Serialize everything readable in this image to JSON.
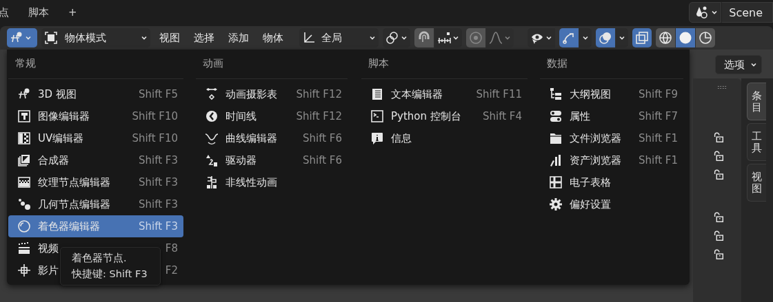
{
  "top_tabs": [
    {
      "label": "点"
    },
    {
      "label": "脚本"
    },
    {
      "label": "+"
    }
  ],
  "scene": {
    "label": "Scene"
  },
  "header": {
    "mode": "物体模式",
    "menus": [
      "视图",
      "选择",
      "添加",
      "物体"
    ],
    "orientation": "全局",
    "toggles": [
      {
        "kind": "snap",
        "on": false
      },
      {
        "kind": "proportional",
        "on": false
      },
      {
        "kind": "visibility",
        "on": false
      },
      {
        "kind": "gizmo",
        "on": true
      },
      {
        "kind": "overlay",
        "on": true
      },
      {
        "kind": "xray",
        "on": true
      }
    ],
    "shading": [
      {
        "kind": "wireframe",
        "selected": false
      },
      {
        "kind": "solid",
        "selected": true
      },
      {
        "kind": "material",
        "selected": false
      }
    ]
  },
  "editor_menu": {
    "columns": [
      {
        "heading": "常规",
        "items": [
          {
            "label": "3D 视图",
            "shortcut": "Shift F5",
            "selected": false
          },
          {
            "label": "图像编辑器",
            "shortcut": "Shift F10",
            "selected": false
          },
          {
            "label": "UV编辑器",
            "shortcut": "Shift F10",
            "selected": false
          },
          {
            "label": "合成器",
            "shortcut": "Shift F3",
            "selected": false
          },
          {
            "label": "纹理节点编辑器",
            "shortcut": "Shift F3",
            "selected": false
          },
          {
            "label": "几何节点编辑器",
            "shortcut": "Shift F3",
            "selected": false
          },
          {
            "label": "着色器编辑器",
            "shortcut": "Shift F3",
            "selected": true
          },
          {
            "label": "视频",
            "shortcut": "F8",
            "selected": false
          },
          {
            "label": "影片",
            "shortcut": "F2",
            "selected": false
          }
        ]
      },
      {
        "heading": "动画",
        "items": [
          {
            "label": "动画摄影表",
            "shortcut": "Shift F12",
            "selected": false
          },
          {
            "label": "时间线",
            "shortcut": "Shift F12",
            "selected": false
          },
          {
            "label": "曲线编辑器",
            "shortcut": "Shift F6",
            "selected": false
          },
          {
            "label": "驱动器",
            "shortcut": "Shift F6",
            "selected": false
          },
          {
            "label": "非线性动画",
            "selected": false
          }
        ]
      },
      {
        "heading": "脚本",
        "items": [
          {
            "label": "文本编辑器",
            "shortcut": "Shift F11",
            "selected": false
          },
          {
            "label": "Python 控制台",
            "shortcut": "Shift F4",
            "selected": false
          },
          {
            "label": "信息",
            "selected": false
          }
        ]
      },
      {
        "heading": "数据",
        "items": [
          {
            "label": "大纲视图",
            "shortcut": "Shift F9",
            "selected": false
          },
          {
            "label": "属性",
            "shortcut": "Shift F7",
            "selected": false
          },
          {
            "label": "文件浏览器",
            "shortcut": "Shift F1",
            "selected": false
          },
          {
            "label": "资产浏览器",
            "shortcut": "Shift F1",
            "selected": false
          },
          {
            "label": "电子表格",
            "selected": false
          },
          {
            "label": "偏好设置",
            "selected": false
          }
        ]
      }
    ]
  },
  "tooltip": {
    "lines": [
      "着色器节点.",
      "快捷键: Shift F3"
    ]
  },
  "sidebar": {
    "dropdown": "选项",
    "tabs": [
      {
        "label": "条目",
        "selected": true
      },
      {
        "label": "工具",
        "selected": false
      },
      {
        "label": "视图",
        "selected": false
      }
    ]
  }
}
